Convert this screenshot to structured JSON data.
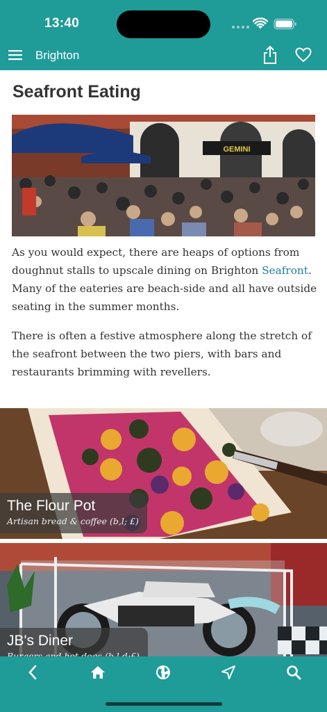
{
  "status_bar": {
    "time": "13:40"
  },
  "nav": {
    "title": "Brighton"
  },
  "page": {
    "title": "Seafront Eating",
    "paragraph1": {
      "before_link": "As you would expect, there are heaps of options from doughnut stalls to upscale dining on Brighton ",
      "link": "Seafront",
      "after_link": ". Many of the eateries are beach-side and all have outside seating in the summer months."
    },
    "paragraph2": "There is often a festive atmosphere along the stretch of the seafront between the two piers, with bars and restaurants brimming with revellers."
  },
  "hero_image": {
    "sign_text": "GEMINI"
  },
  "cards": [
    {
      "title": "The Flour Pot",
      "subtitle": "Artisan bread & coffee (b,l; £)"
    },
    {
      "title": "JB's Diner",
      "subtitle": "Burgers and hot dogs (b,l,d;£)"
    }
  ],
  "bottom_tabs": [
    "back",
    "home",
    "globe",
    "location",
    "search"
  ],
  "colors": {
    "brand": "#1f9b98",
    "link": "#1f7f9a",
    "text": "#333333"
  }
}
